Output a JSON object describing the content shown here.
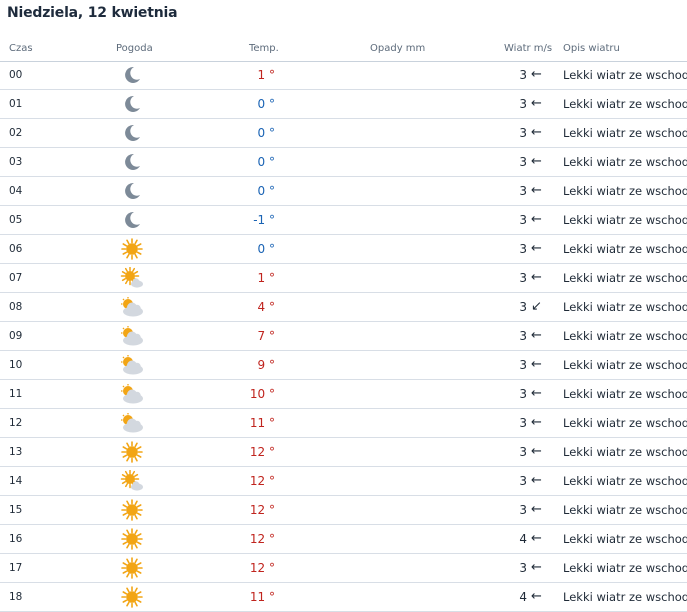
{
  "day_title": "Niedziela, 12 kwietnia",
  "columns": {
    "time": "Czas",
    "weather": "Pogoda",
    "temp": "Temp.",
    "precip": "Opady mm",
    "wind": "Wiatr m/s",
    "wind_desc": "Opis wiatru"
  },
  "colors": {
    "temp_warm": "#c0241e",
    "temp_cold": "#1a63b4",
    "moon": "#7d8a98",
    "sun": "#f2a515",
    "cloud": "#d3d8df"
  },
  "rows": [
    {
      "hour": "00",
      "icon": "moon-icon",
      "temp": "1 °",
      "temp_color": "#c0241e",
      "wind": "3",
      "arrow": "←",
      "desc": "Lekki wiatr ze wschodu"
    },
    {
      "hour": "01",
      "icon": "moon-icon",
      "temp": "0 °",
      "temp_color": "#1a63b4",
      "wind": "3",
      "arrow": "←",
      "desc": "Lekki wiatr ze wschodu"
    },
    {
      "hour": "02",
      "icon": "moon-icon",
      "temp": "0 °",
      "temp_color": "#1a63b4",
      "wind": "3",
      "arrow": "←",
      "desc": "Lekki wiatr ze wschodu"
    },
    {
      "hour": "03",
      "icon": "moon-icon",
      "temp": "0 °",
      "temp_color": "#1a63b4",
      "wind": "3",
      "arrow": "←",
      "desc": "Lekki wiatr ze wschodu"
    },
    {
      "hour": "04",
      "icon": "moon-icon",
      "temp": "0 °",
      "temp_color": "#1a63b4",
      "wind": "3",
      "arrow": "←",
      "desc": "Lekki wiatr ze wschodu"
    },
    {
      "hour": "05",
      "icon": "moon-icon",
      "temp": "-1 °",
      "temp_color": "#1a63b4",
      "wind": "3",
      "arrow": "←",
      "desc": "Lekki wiatr ze wschodu"
    },
    {
      "hour": "06",
      "icon": "sun-icon",
      "temp": "0 °",
      "temp_color": "#1a63b4",
      "wind": "3",
      "arrow": "←",
      "desc": "Lekki wiatr ze wschodu"
    },
    {
      "hour": "07",
      "icon": "sun-cloud-icon",
      "temp": "1 °",
      "temp_color": "#c0241e",
      "wind": "3",
      "arrow": "←",
      "desc": "Lekki wiatr ze wschodu"
    },
    {
      "hour": "08",
      "icon": "cloud-sun-icon",
      "temp": "4 °",
      "temp_color": "#c0241e",
      "wind": "3",
      "arrow": "↙",
      "desc": "Lekki wiatr ze wschodu"
    },
    {
      "hour": "09",
      "icon": "cloud-sun-icon",
      "temp": "7 °",
      "temp_color": "#c0241e",
      "wind": "3",
      "arrow": "←",
      "desc": "Lekki wiatr ze wschodu"
    },
    {
      "hour": "10",
      "icon": "cloud-sun-icon",
      "temp": "9 °",
      "temp_color": "#c0241e",
      "wind": "3",
      "arrow": "←",
      "desc": "Lekki wiatr ze wschodu"
    },
    {
      "hour": "11",
      "icon": "cloud-sun-icon",
      "temp": "10 °",
      "temp_color": "#c0241e",
      "wind": "3",
      "arrow": "←",
      "desc": "Lekki wiatr ze wschodu"
    },
    {
      "hour": "12",
      "icon": "cloud-sun-icon",
      "temp": "11 °",
      "temp_color": "#c0241e",
      "wind": "3",
      "arrow": "←",
      "desc": "Lekki wiatr ze wschodu"
    },
    {
      "hour": "13",
      "icon": "sun-icon",
      "temp": "12 °",
      "temp_color": "#c0241e",
      "wind": "3",
      "arrow": "←",
      "desc": "Lekki wiatr ze wschodu"
    },
    {
      "hour": "14",
      "icon": "sun-cloud-icon",
      "temp": "12 °",
      "temp_color": "#c0241e",
      "wind": "3",
      "arrow": "←",
      "desc": "Lekki wiatr ze wschodu"
    },
    {
      "hour": "15",
      "icon": "sun-icon",
      "temp": "12 °",
      "temp_color": "#c0241e",
      "wind": "3",
      "arrow": "←",
      "desc": "Lekki wiatr ze wschodu"
    },
    {
      "hour": "16",
      "icon": "sun-icon",
      "temp": "12 °",
      "temp_color": "#c0241e",
      "wind": "4",
      "arrow": "←",
      "desc": "Lekki wiatr ze wschodu"
    },
    {
      "hour": "17",
      "icon": "sun-icon",
      "temp": "12 °",
      "temp_color": "#c0241e",
      "wind": "3",
      "arrow": "←",
      "desc": "Lekki wiatr ze wschodu"
    },
    {
      "hour": "18",
      "icon": "sun-icon",
      "temp": "11 °",
      "temp_color": "#c0241e",
      "wind": "4",
      "arrow": "←",
      "desc": "Lekki wiatr ze wschodu"
    }
  ]
}
